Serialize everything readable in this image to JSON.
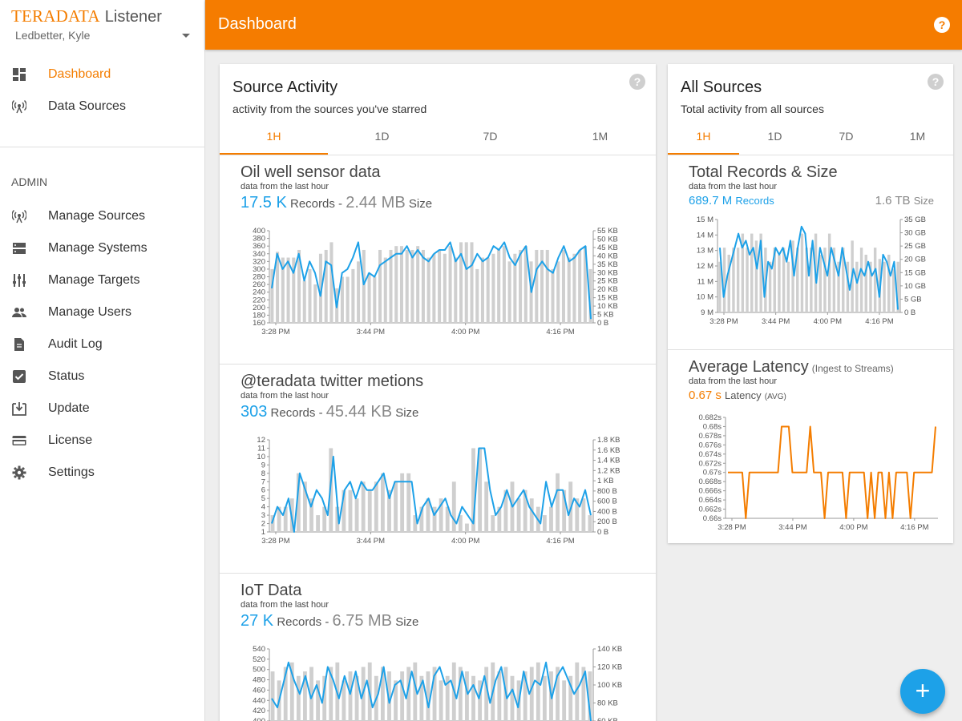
{
  "brand": {
    "logo": "TERADATA",
    "app": "Listener"
  },
  "user": {
    "name": "Ledbetter, Kyle"
  },
  "nav": {
    "main": [
      {
        "label": "Dashboard",
        "icon": "dashboard-icon",
        "active": true
      },
      {
        "label": "Data Sources",
        "icon": "antenna-icon",
        "active": false
      }
    ],
    "admin_heading": "ADMIN",
    "admin": [
      {
        "label": "Manage Sources",
        "icon": "antenna-icon"
      },
      {
        "label": "Manage Systems",
        "icon": "dns-icon"
      },
      {
        "label": "Manage Targets",
        "icon": "tune-icon"
      },
      {
        "label": "Manage Users",
        "icon": "people-icon"
      },
      {
        "label": "Audit Log",
        "icon": "document-icon"
      },
      {
        "label": "Status",
        "icon": "check-box-icon"
      },
      {
        "label": "Update",
        "icon": "download-icon"
      },
      {
        "label": "License",
        "icon": "credit-card-icon"
      },
      {
        "label": "Settings",
        "icon": "gear-icon"
      }
    ]
  },
  "topbar": {
    "title": "Dashboard",
    "help": "?"
  },
  "source_activity": {
    "title": "Source Activity",
    "subtitle": "activity from the sources you've starred",
    "tabs": [
      "1H",
      "1D",
      "7D",
      "1M"
    ],
    "active_tab": "1H",
    "sections": [
      {
        "title": "Oil well sensor data",
        "note": "data from the last hour",
        "records": "17.5 K",
        "records_label": "Records",
        "size": "2.44 MB",
        "size_label": "Size",
        "chart_data": {
          "type": "bar+line",
          "x_ticks": [
            "3:28 PM",
            "3:44 PM",
            "4:00 PM",
            "4:16 PM"
          ],
          "y_left_ticks": [
            "400",
            "380",
            "360",
            "340",
            "320",
            "300",
            "280",
            "260",
            "240",
            "220",
            "200",
            "180",
            "160"
          ],
          "y_left_lim": [
            160,
            400
          ],
          "y_right_ticks": [
            "55 KB",
            "50 KB",
            "45 KB",
            "40 KB",
            "35 KB",
            "30 KB",
            "25 KB",
            "20 KB",
            "15 KB",
            "10 KB",
            "5 KB",
            "0 B"
          ],
          "bars": [
            300,
            345,
            330,
            330,
            330,
            350,
            270,
            300,
            260,
            340,
            350,
            370,
            250,
            280,
            280,
            300,
            320,
            350,
            290,
            280,
            350,
            330,
            350,
            360,
            360,
            350,
            350,
            360,
            350,
            330,
            340,
            350,
            340,
            360,
            330,
            370,
            370,
            370,
            300,
            330,
            330,
            340,
            350,
            360,
            320,
            340,
            350,
            360,
            320,
            350,
            350,
            350,
            300,
            320,
            350,
            330,
            340,
            350,
            360,
            300
          ],
          "line": [
            250,
            340,
            300,
            320,
            290,
            340,
            270,
            320,
            290,
            230,
            320,
            310,
            200,
            290,
            300,
            330,
            370,
            260,
            290,
            280,
            310,
            320,
            330,
            340,
            340,
            360,
            330,
            350,
            330,
            320,
            340,
            350,
            350,
            370,
            320,
            340,
            300,
            310,
            340,
            320,
            330,
            360,
            350,
            370,
            330,
            310,
            340,
            360,
            240,
            300,
            320,
            300,
            290,
            330,
            360,
            320,
            330,
            350,
            360,
            170
          ]
        }
      },
      {
        "title": "@teradata twitter metions",
        "note": "data from the last hour",
        "records": "303",
        "records_label": "Records",
        "size": "45.44 KB",
        "size_label": "Size",
        "chart_data": {
          "type": "bar+line",
          "x_ticks": [
            "3:28 PM",
            "3:44 PM",
            "4:00 PM",
            "4:16 PM"
          ],
          "y_left_ticks": [
            "12",
            "11",
            "10",
            "9",
            "8",
            "7",
            "6",
            "5",
            "4",
            "3",
            "2",
            "1"
          ],
          "y_left_lim": [
            1,
            12
          ],
          "y_right_ticks": [
            "1.8 KB",
            "1.6 KB",
            "1.4 KB",
            "1.2 KB",
            "1 KB",
            "800 B",
            "600 B",
            "400 B",
            "200 B",
            "0 B"
          ],
          "bars": [
            3,
            4,
            4,
            5,
            8,
            7,
            5,
            3,
            4,
            11,
            4,
            6,
            6,
            5,
            7,
            6,
            7,
            8,
            6,
            7,
            8,
            8,
            3,
            4,
            5,
            4,
            5,
            4,
            7,
            3,
            2,
            11,
            11,
            7,
            3,
            4,
            6,
            7,
            5,
            6,
            5,
            4,
            3,
            4,
            8,
            6,
            7,
            5,
            5,
            3
          ],
          "line": [
            2,
            4,
            3,
            5,
            1,
            8,
            6,
            4,
            6,
            5,
            3,
            10,
            2,
            6,
            7,
            5,
            7,
            6,
            6,
            7,
            8,
            5,
            7,
            7,
            7,
            7,
            2,
            4,
            5,
            3,
            4,
            5,
            3,
            2,
            4,
            3,
            2,
            11,
            11,
            6,
            3,
            4,
            6,
            4,
            5,
            6,
            4,
            3,
            2,
            7,
            4,
            6,
            6,
            3,
            5,
            4,
            6,
            3
          ]
        }
      },
      {
        "title": "IoT Data",
        "note": "data from the last hour",
        "records": "27 K",
        "records_label": "Records",
        "size": "6.75 MB",
        "size_label": "Size",
        "chart_data": {
          "type": "bar+line",
          "x_ticks": [],
          "y_left_ticks": [
            "540",
            "520",
            "500",
            "480",
            "460",
            "440",
            "420",
            "400"
          ],
          "y_left_lim": [
            380,
            540
          ],
          "y_right_ticks": [
            "140 KB",
            "120 KB",
            "100 KB",
            "80 KB",
            "60 KB"
          ],
          "bars": [
            490,
            470,
            500,
            510,
            480,
            490,
            500,
            470,
            480,
            500,
            510,
            470,
            490,
            480,
            500,
            510,
            480,
            500,
            490,
            470,
            490,
            500,
            510,
            480,
            490,
            500,
            470,
            480,
            510,
            500,
            490,
            480,
            470,
            500,
            510,
            490,
            500,
            480,
            470,
            490,
            500,
            510,
            480,
            490,
            500,
            470,
            480,
            510,
            500,
            490
          ],
          "line": [
            430,
            410,
            460,
            510,
            470,
            440,
            480,
            430,
            460,
            420,
            500,
            470,
            430,
            480,
            440,
            490,
            430,
            470,
            410,
            440,
            500,
            420,
            460,
            470,
            430,
            490,
            440,
            470,
            410,
            480,
            500,
            460,
            470,
            430,
            490,
            440,
            460,
            430,
            480,
            420,
            470,
            500,
            430,
            450,
            410,
            490,
            440,
            470,
            460,
            510,
            430,
            480,
            500,
            470,
            440,
            460,
            490,
            380
          ]
        }
      }
    ]
  },
  "all_sources": {
    "title": "All Sources",
    "subtitle": "Total activity from all sources",
    "tabs": [
      "1H",
      "1D",
      "7D",
      "1M"
    ],
    "active_tab": "1H",
    "total": {
      "title": "Total Records & Size",
      "note": "data from the last hour",
      "records": "689.7 M",
      "records_label": "Records",
      "size": "1.6 TB",
      "size_label": "Size",
      "chart_data": {
        "type": "bar+line",
        "x_ticks": [
          "3:28 PM",
          "3:44 PM",
          "4:00 PM",
          "4:16 PM"
        ],
        "y_left_ticks": [
          "15 M",
          "14 M",
          "13 M",
          "12 M",
          "11 M",
          "10 M",
          "9 M"
        ],
        "y_left_lim": [
          8.4,
          15
        ],
        "y_right_ticks": [
          "35 GB",
          "30 GB",
          "25 GB",
          "20 GB",
          "15 GB",
          "10 GB",
          "5 GB",
          "0 B"
        ],
        "bars": [
          12,
          13,
          12.5,
          13,
          13,
          14,
          13,
          14,
          13.5,
          14,
          13,
          12,
          13,
          12.5,
          13,
          12,
          13.5,
          13,
          14,
          13,
          13,
          14,
          12.5,
          13,
          14,
          13,
          12,
          13,
          12,
          13.5,
          12,
          13,
          12.5,
          12,
          13,
          12.2,
          12,
          12.5,
          11.5,
          12
        ],
        "line": [
          13,
          9.5,
          11,
          12,
          13,
          14,
          13,
          13.5,
          12.5,
          13,
          11.5,
          13.5,
          9.5,
          12,
          11.5,
          13,
          12.5,
          13,
          12,
          13.5,
          11,
          13,
          14.5,
          14,
          11,
          13.5,
          10.5,
          13,
          12,
          11,
          13,
          12,
          11,
          13,
          11.5,
          10,
          11.5,
          10.5,
          11.5,
          11,
          12,
          11,
          11.5,
          9.5,
          12.5,
          12,
          11,
          12,
          8.6
        ]
      }
    },
    "latency": {
      "title": "Average Latency",
      "title_sub": "(Ingest to Streams)",
      "note": "data from the last hour",
      "value": "0.67 s",
      "value_label": "Latency",
      "value_sub": "(AVG)",
      "chart_data": {
        "type": "line",
        "x_ticks": [
          "3:28 PM",
          "3:44 PM",
          "4:00 PM",
          "4:16 PM"
        ],
        "y_ticks": [
          "0.682s",
          "0.68s",
          "0.678s",
          "0.676s",
          "0.674s",
          "0.672s",
          "0.67s",
          "0.668s",
          "0.666s",
          "0.664s",
          "0.662s",
          "0.66s"
        ],
        "y_lim": [
          0.66,
          0.682
        ],
        "line": [
          0.67,
          0.67,
          0.67,
          0.67,
          0.67,
          0.66,
          0.67,
          0.67,
          0.67,
          0.67,
          0.67,
          0.67,
          0.67,
          0.67,
          0.67,
          0.68,
          0.68,
          0.68,
          0.67,
          0.67,
          0.67,
          0.67,
          0.67,
          0.68,
          0.67,
          0.67,
          0.67,
          0.66,
          0.67,
          0.67,
          0.67,
          0.67,
          0.67,
          0.66,
          0.67,
          0.67,
          0.67,
          0.67,
          0.67,
          0.66,
          0.67,
          0.66,
          0.67,
          0.67,
          0.66,
          0.67,
          0.66,
          0.67,
          0.67,
          0.67,
          0.67,
          0.66,
          0.67,
          0.67,
          0.67,
          0.67,
          0.67,
          0.67,
          0.68
        ]
      }
    }
  },
  "fab": {
    "label": "+"
  }
}
